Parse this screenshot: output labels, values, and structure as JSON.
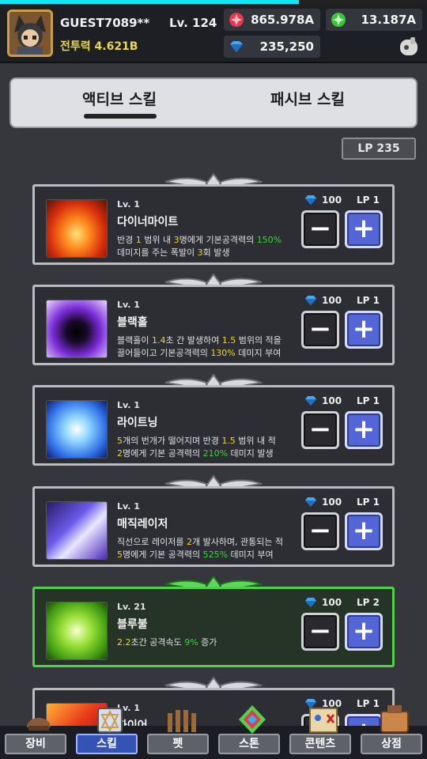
{
  "player": {
    "name": "GUEST7089**",
    "level": "Lv. 124",
    "power": "전투력 4.621B"
  },
  "currency": {
    "ruby": "865.978A",
    "emerald": "13.187A",
    "diamond": "235,250"
  },
  "loading_progress": 0.7,
  "tabs": {
    "active": "액티브 스킬",
    "passive": "패시브 스킬"
  },
  "lp_total": "LP 235",
  "skills": [
    {
      "level": "Lv. 1",
      "name": "다이너마이트",
      "cost": "100",
      "lp": "LP 1",
      "desc": [
        [
          "반경 ",
          ""
        ],
        [
          "1",
          "y"
        ],
        [
          " 범위 내 ",
          ""
        ],
        [
          "3",
          "y"
        ],
        [
          "명에게 기본공격력의 ",
          ""
        ],
        [
          "150%",
          "g"
        ],
        [
          "\n데미지를 주는 폭발이 ",
          ""
        ],
        [
          "3",
          "y"
        ],
        [
          "회 발생",
          ""
        ]
      ]
    },
    {
      "level": "Lv. 1",
      "name": "블랙홀",
      "cost": "100",
      "lp": "LP 1",
      "desc": [
        [
          "블랙홀이 ",
          ""
        ],
        [
          "1.4",
          "y"
        ],
        [
          "초 간 발생하여 ",
          ""
        ],
        [
          "1.5",
          "y"
        ],
        [
          " 범위의 적을\n끌어들이고 기본공격력의 ",
          ""
        ],
        [
          "130%",
          "y"
        ],
        [
          " 데미지 부여",
          ""
        ]
      ]
    },
    {
      "level": "Lv. 1",
      "name": "라이트닝",
      "cost": "100",
      "lp": "LP 1",
      "desc": [
        [
          "5",
          "y"
        ],
        [
          "개의 번개가 떨어지며 반경 ",
          ""
        ],
        [
          "1.5",
          "y"
        ],
        [
          " 범위 내 적\n",
          ""
        ],
        [
          "2",
          "y"
        ],
        [
          "명에게 기본 공격력의 ",
          ""
        ],
        [
          "210%",
          "g"
        ],
        [
          " 데미지 발생",
          ""
        ]
      ]
    },
    {
      "level": "Lv. 1",
      "name": "매직레이저",
      "cost": "100",
      "lp": "LP 1",
      "desc": [
        [
          "직선으로 레이저를 ",
          ""
        ],
        [
          "2",
          "y"
        ],
        [
          "개 발사하며, 관통되는 적\n",
          ""
        ],
        [
          "5",
          "y"
        ],
        [
          "명에게 기본 공격력의 ",
          ""
        ],
        [
          "525%",
          "g"
        ],
        [
          " 데미지 부여",
          ""
        ]
      ]
    },
    {
      "level": "Lv. 21",
      "name": "블루불",
      "cost": "100",
      "lp": "LP 2",
      "active": true,
      "desc": [
        [
          "2.2",
          "y"
        ],
        [
          "초간 공격속도 ",
          ""
        ],
        [
          "9%",
          "g"
        ],
        [
          " 증가",
          ""
        ]
      ]
    },
    {
      "level": "Lv. 1",
      "name": "파이어",
      "cost": "100",
      "lp": "LP 1",
      "desc": []
    }
  ],
  "nav": [
    "장비",
    "스킬",
    "펫",
    "스톤",
    "콘텐츠",
    "상점"
  ],
  "nav_selected": 1,
  "icons": [
    "ruby-icon",
    "emerald-icon",
    "diamond-icon",
    "profile-icon",
    "wing-ornament-icon",
    "minus-icon",
    "plus-icon"
  ],
  "colors": {
    "accent_blue": "#5466d6",
    "active_green": "#4fd14a",
    "value_yellow": "#f2d52c",
    "value_green": "#3bd23b",
    "loading": "#12e6f2"
  }
}
